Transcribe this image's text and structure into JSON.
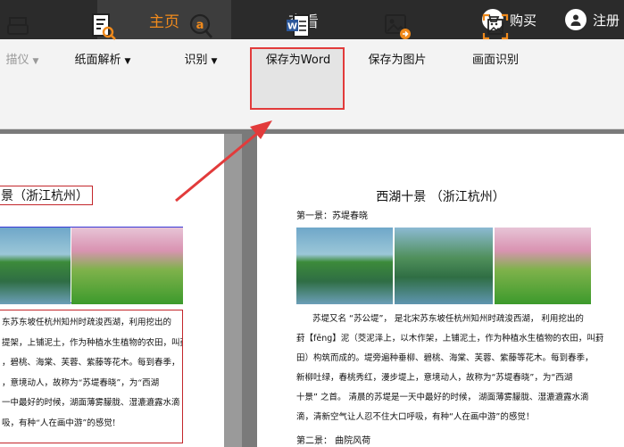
{
  "tabs": {
    "home": "主页",
    "view": "查看"
  },
  "top_right": {
    "buy": "购买",
    "register": "注册"
  },
  "toolbar": {
    "scanner": "描仪",
    "paper_parse": "纸面解析",
    "recognize": "识别",
    "save_word": "保存为Word",
    "save_image": "保存为图片",
    "screen_recognize": "画面识别"
  },
  "left_page": {
    "title": "景（浙江杭州）",
    "lines": [
      "东苏东坡任杭州知州时疏浚西湖，利用挖出的",
      "提架，上铺泥土，作为种植水生植物的农田，叫葑",
      "，碧桃、海棠、芙蓉、紫藤等花木。每到春季，",
      "，意境动人，故称为“苏堤春晓”，为“西湖",
      "一中最好的时候，湖面薄雾朦胧、湿漉漉露水滴",
      "吸，有种“人在画中游”的感觉!"
    ]
  },
  "right_page": {
    "title": "西湖十景 （浙江杭州）",
    "subtitle": "第一景：苏堤春晓",
    "lines": [
      "苏堤又名 “苏公堤”， 是北宋苏东坡任杭州知州时疏浚西湖， 利用挖出的",
      "葑【fēng】泥（茭泥泽上，以木作架，上铺泥土，作为种植水生植物的农田，叫葑",
      "田）构筑而成的。堤旁遍种垂柳、碧桃、海棠、芙蓉、紫藤等花木。每到春季，",
      "新柳吐绿，春桃秀红，漫步堤上，意境动人，故称为“苏堤春晓”，为“西湖",
      "十景” 之首。 清晨的苏堤是一天中最好的时候， 湖面薄雾朦胧、湿漉漉露水滴",
      "滴，清新空气让人忍不住大口呼吸，有种“人在画中游”的感觉！"
    ],
    "next": "第二景： 曲院风荷"
  },
  "colors": {
    "accent": "#f08a1c",
    "highlight_border": "#e23b3b"
  }
}
